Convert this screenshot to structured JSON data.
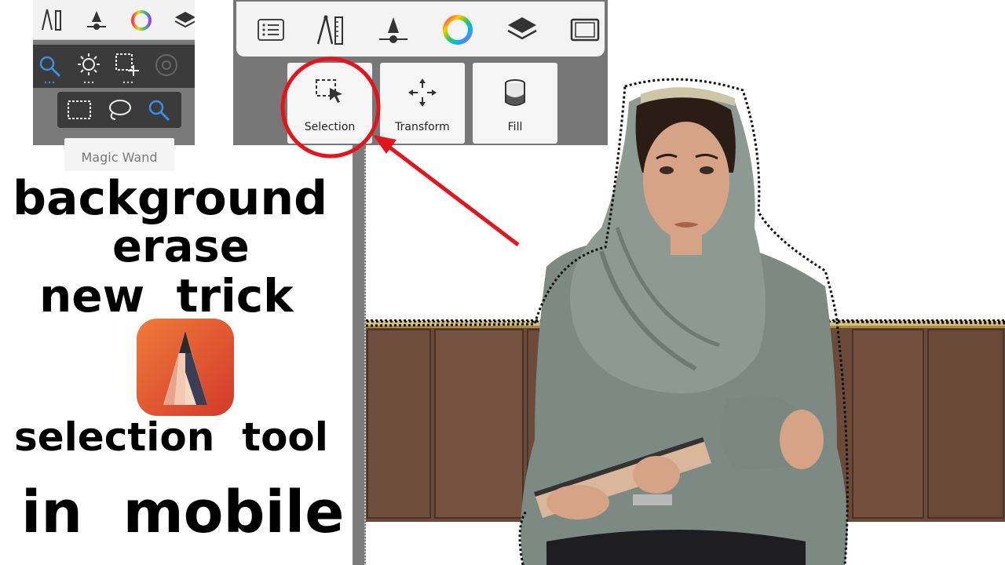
{
  "mini_panel": {
    "tooltip": "Magic Wand",
    "top_icons": [
      "compass-ruler-icon",
      "brush-size-icon",
      "color-wheel-icon",
      "layers-icon"
    ],
    "selection_modes": [
      "magic-wand-icon",
      "auto-select-icon",
      "add-selection-icon",
      "circle-target-icon"
    ],
    "sub_modes": [
      "rect-select-icon",
      "lasso-select-icon",
      "magic-wand-icon"
    ]
  },
  "toolbar": {
    "icons": [
      "list-icon",
      "compass-ruler-icon",
      "brush-size-icon",
      "color-wheel-icon",
      "layers-icon",
      "canvas-icon"
    ],
    "tools": [
      {
        "label": "Selection",
        "icon": "selection-icon"
      },
      {
        "label": "Transform",
        "icon": "move-arrows-icon"
      },
      {
        "label": "Fill",
        "icon": "paint-bucket-icon"
      }
    ]
  },
  "headline": {
    "line1": "background",
    "line2": "erase",
    "line3": "new  trick",
    "line4": "selection  tool",
    "line5": "in  mobile"
  },
  "colors": {
    "highlight_red": "#e3141b",
    "active_blue": "#3a8ee6",
    "app_orange": "#e8602a"
  }
}
